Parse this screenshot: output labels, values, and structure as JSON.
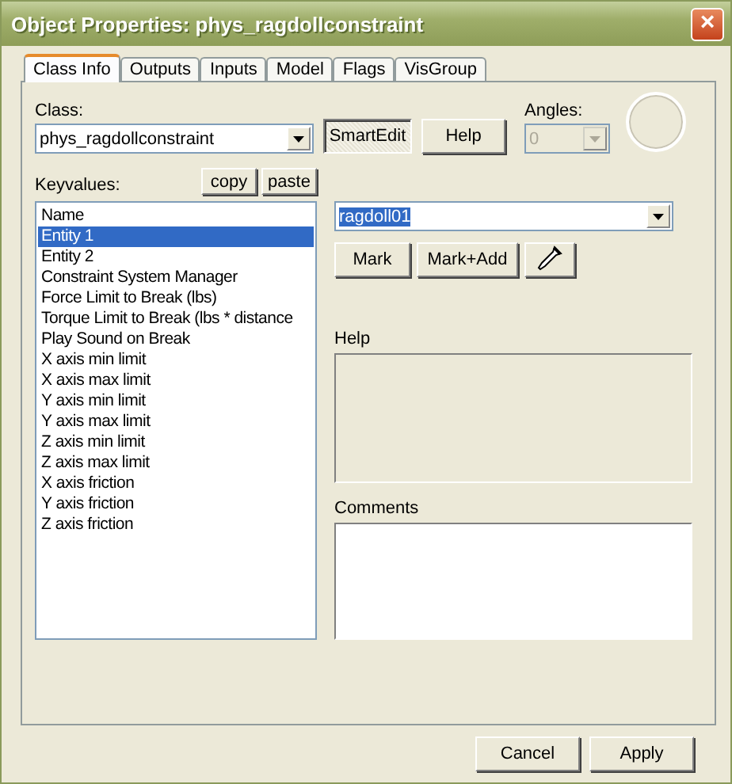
{
  "window": {
    "title": "Object Properties: phys_ragdollconstraint",
    "close": "×"
  },
  "tabs": [
    {
      "label": "Class Info",
      "selected": true
    },
    {
      "label": "Outputs",
      "selected": false
    },
    {
      "label": "Inputs",
      "selected": false
    },
    {
      "label": "Model",
      "selected": false
    },
    {
      "label": "Flags",
      "selected": false
    },
    {
      "label": "VisGroup",
      "selected": false
    }
  ],
  "class": {
    "label": "Class:",
    "value": "phys_ragdollconstraint"
  },
  "smartedit": {
    "label": "SmartEdit",
    "pressed": true
  },
  "help_button": "Help",
  "angles": {
    "label": "Angles:",
    "value": "0",
    "disabled": true
  },
  "keyvalues": {
    "label": "Keyvalues:",
    "buttons": [
      "copy",
      "paste"
    ],
    "items": [
      {
        "label": "Name",
        "selected": false
      },
      {
        "label": "Entity 1",
        "selected": true
      },
      {
        "label": "Entity 2",
        "selected": false
      },
      {
        "label": "Constraint System Manager",
        "selected": false
      },
      {
        "label": "Force Limit to Break (lbs)",
        "selected": false
      },
      {
        "label": "Torque Limit to Break (lbs * distance",
        "selected": false
      },
      {
        "label": "Play Sound on Break",
        "selected": false
      },
      {
        "label": "X axis min limit",
        "selected": false
      },
      {
        "label": "X axis max limit",
        "selected": false
      },
      {
        "label": "Y axis min limit",
        "selected": false
      },
      {
        "label": "Y axis max limit",
        "selected": false
      },
      {
        "label": "Z axis min limit",
        "selected": false
      },
      {
        "label": "Z axis max limit",
        "selected": false
      },
      {
        "label": "X axis friction",
        "selected": false
      },
      {
        "label": "Y axis friction",
        "selected": false
      },
      {
        "label": "Z axis friction",
        "selected": false
      }
    ]
  },
  "value": {
    "text": "ragdoll01",
    "highlighted": true
  },
  "mark_buttons": [
    "Mark",
    "Mark+Add"
  ],
  "help": {
    "label": "Help"
  },
  "comments": {
    "label": "Comments"
  },
  "footer_buttons": [
    "Cancel",
    "Apply"
  ]
}
